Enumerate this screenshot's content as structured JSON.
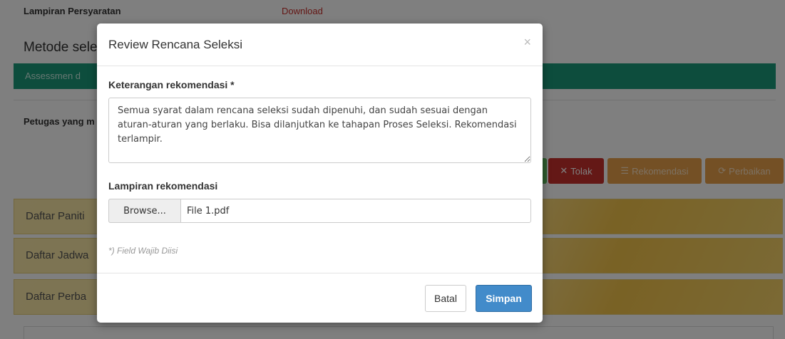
{
  "background": {
    "lampiran_label": "Lampiran Persyaratan",
    "lampiran_link": "Download",
    "metode_label": "Metode sele",
    "green_bar_text": "Assessmen d",
    "petugas_label": "Petugas yang m",
    "actions": {
      "tolak": "Tolak",
      "rekomendasi": "Rekomendasi",
      "perbaikan": "Perbaikan"
    },
    "panels": [
      "Daftar Paniti",
      "Daftar Jadwa",
      "Daftar Perba"
    ]
  },
  "modal": {
    "title": "Review Rencana Seleksi",
    "close_icon": "×",
    "keterangan_label": "Keterangan rekomendasi *",
    "keterangan_value": "Semua syarat dalam rencana seleksi sudah dipenuhi, dan sudah sesuai dengan aturan-aturan yang berlaku. Bisa dilanjutkan ke tahapan Proses Seleksi. Rekomendasi terlampir.",
    "lampiran_label": "Lampiran rekomendasi",
    "browse_label": "Browse...",
    "file_name": "File 1.pdf",
    "required_note": "*) Field Wajib Diisi",
    "batal_label": "Batal",
    "simpan_label": "Simpan"
  },
  "colors": {
    "primary": "#428bca",
    "danger": "#c9302c",
    "warning": "#e8a04a",
    "success": "#1a9b7a"
  }
}
